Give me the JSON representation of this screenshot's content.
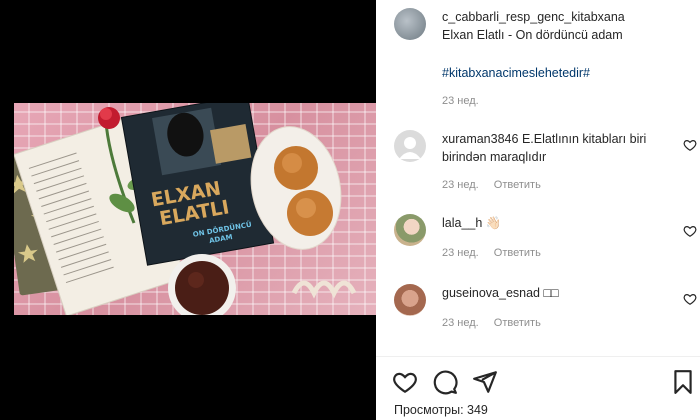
{
  "post": {
    "author": "c_cabbarli_resp_genc_kitabxana",
    "caption": "Elxan Elatlı - On dördüncü adam",
    "hashtag": "#kitabxanacimeslehetedir#",
    "time": "23 нед."
  },
  "book": {
    "title_line1": "ELXAN",
    "title_line2": "ELATLI",
    "subtitle_line1": "ON DÖRDÜNCÜ",
    "subtitle_line2": "ADAM"
  },
  "comments": [
    {
      "user": "xuraman3846",
      "text": "E.Elatlının kitabları biri birindən maraqlıdır",
      "time": "23 нед.",
      "reply_label": "Ответить"
    },
    {
      "user": "lala__h",
      "text": "👋🏻",
      "time": "23 нед.",
      "reply_label": "Ответить"
    },
    {
      "user": "guseinova_esnad",
      "text": "□□",
      "time": "23 нед.",
      "reply_label": "Ответить"
    }
  ],
  "actions": {
    "views_label": "Просмотры:",
    "views_count": "349"
  },
  "icons": [
    "heart-icon",
    "comment-icon",
    "share-icon",
    "bookmark-icon",
    "like-comment-icon"
  ]
}
